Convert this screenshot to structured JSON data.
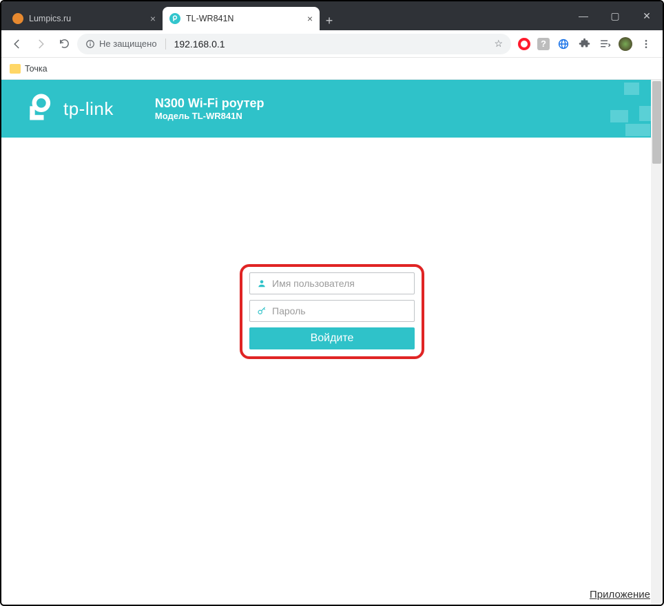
{
  "browser": {
    "tabs": [
      {
        "title": "Lumpics.ru",
        "active": false
      },
      {
        "title": "TL-WR841N",
        "active": true
      }
    ],
    "security_label": "Не защищено",
    "url": "192.168.0.1",
    "bookmark": "Точка"
  },
  "banner": {
    "brand": "tp-link",
    "product_line1": "N300 Wi-Fi роутер",
    "product_line2": "Модель TL-WR841N"
  },
  "login": {
    "username_placeholder": "Имя пользователя",
    "password_placeholder": "Пароль",
    "button": "Войдите"
  },
  "footer": {
    "app_link": "Приложение"
  }
}
